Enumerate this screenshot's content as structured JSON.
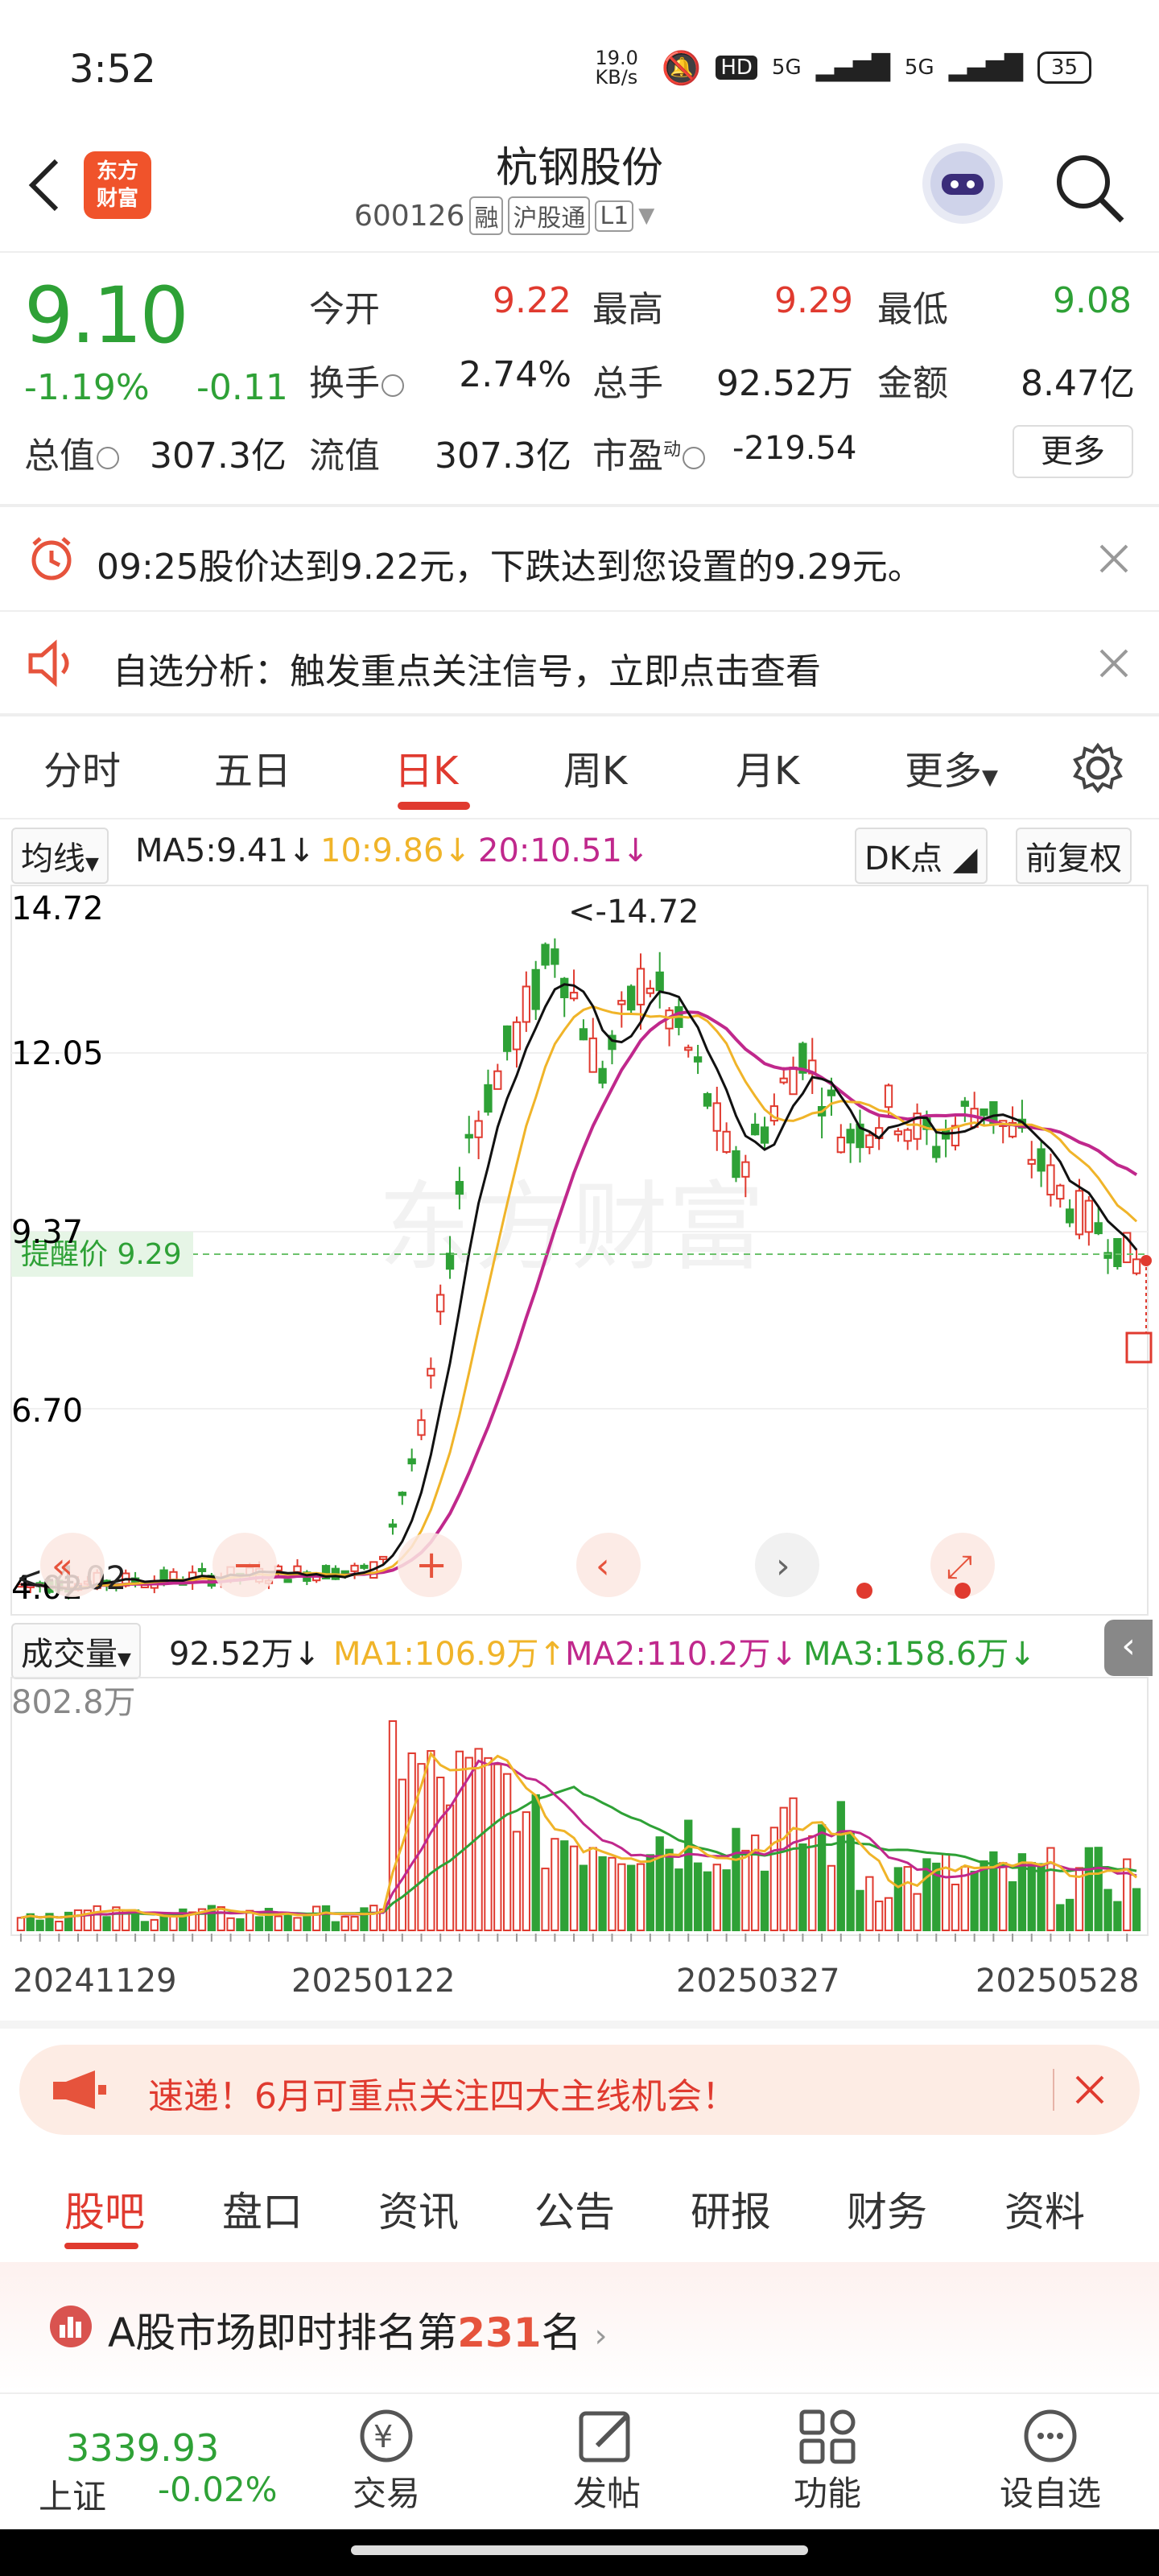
{
  "status": {
    "time": "3:52",
    "net_speed": "19.0 KB/s",
    "signal_1": "5G",
    "signal_2": "5G",
    "battery": "35"
  },
  "header": {
    "logo_text": "东方财富",
    "title": "杭钢股份",
    "code": "600126",
    "tags": [
      "融",
      "沪股通",
      "L1"
    ]
  },
  "quote": {
    "price": "9.10",
    "change_pct": "-1.19%",
    "change_abs": "-0.11",
    "open_label": "今开",
    "open": "9.22",
    "high_label": "最高",
    "high": "9.29",
    "low_label": "最低",
    "low": "9.08",
    "turnover_label": "换手",
    "turnover": "2.74%",
    "volume_label": "总手",
    "volume": "92.52万",
    "amount_label": "金额",
    "amount": "8.47亿",
    "mktcap_label": "总值",
    "mktcap": "307.3亿",
    "float_label": "流值",
    "float": "307.3亿",
    "pe_label": "市盈",
    "pe_sup": "动",
    "pe": "-219.54",
    "more": "更多"
  },
  "notices": {
    "alert": "09:25股价达到9.22元，下跌达到您设置的9.29元。",
    "analysis": "自选分析：触发重点关注信号，立即点击查看"
  },
  "tabs": [
    "分时",
    "五日",
    "日K",
    "周K",
    "月K",
    "更多"
  ],
  "ma_bar": {
    "selector": "均线",
    "ma5": "MA5:9.41",
    "ma10": "10:9.86",
    "ma20": "20:10.51",
    "dk": "DK点",
    "adjust": "前复权"
  },
  "chart": {
    "y_labels": [
      "14.72",
      "12.05",
      "9.37",
      "6.70",
      "4.02"
    ],
    "max_marker": "<-14.72",
    "min_marker": "<-4.02",
    "reminder": "提醒价 9.29",
    "watermark": "东方财富"
  },
  "volume_bar": {
    "selector": "成交量",
    "vol": "92.52万",
    "ma1": "MA1:106.9万",
    "ma2": "MA2:110.2万",
    "ma3": "MA3:158.6万",
    "max_label": "802.8万"
  },
  "dates": [
    "20241129",
    "20250122",
    "20250327",
    "20250528"
  ],
  "banner": {
    "text": "速递！6月可重点关注四大主线机会！"
  },
  "subtabs": [
    "股吧",
    "盘口",
    "资讯",
    "公告",
    "研报",
    "财务",
    "资料"
  ],
  "rank": {
    "prefix": "A股市场即时排名第",
    "number": "231",
    "suffix": "名"
  },
  "bottom_nav": {
    "index_value": "3339.93",
    "index_name": "上证",
    "index_change": "-0.02%",
    "items": [
      "交易",
      "发帖",
      "功能",
      "设自选"
    ]
  },
  "colors": {
    "up": "#e03a2f",
    "down": "#2ea136",
    "ma5": "#111111",
    "ma10": "#f0b429",
    "ma20": "#c0288c"
  }
}
